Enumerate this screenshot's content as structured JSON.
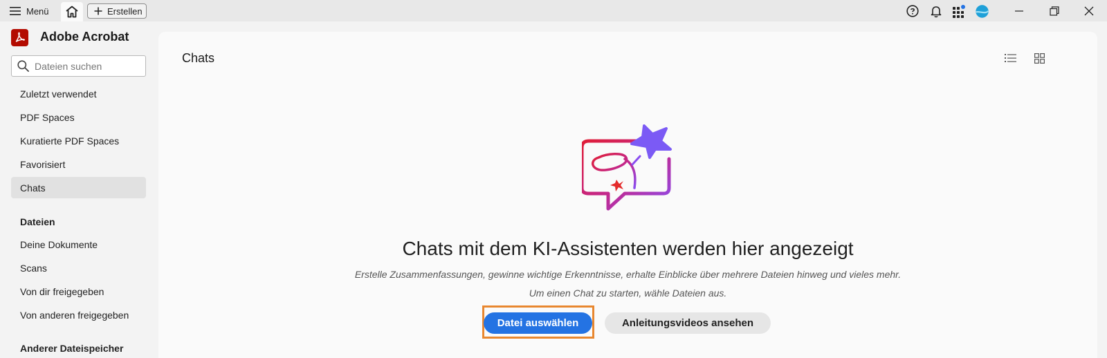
{
  "titlebar": {
    "menu_label": "Menü",
    "create_label": "Erstellen"
  },
  "sidebar": {
    "app_title": "Adobe Acrobat",
    "search_placeholder": "Dateien suchen",
    "nav": [
      {
        "label": "Zuletzt verwendet",
        "active": false
      },
      {
        "label": "PDF Spaces",
        "active": false
      },
      {
        "label": "Kuratierte PDF Spaces",
        "active": false
      },
      {
        "label": "Favorisiert",
        "active": false
      },
      {
        "label": "Chats",
        "active": true
      }
    ],
    "files_heading": "Dateien",
    "files": [
      {
        "label": "Deine Dokumente"
      },
      {
        "label": "Scans"
      },
      {
        "label": "Von dir freigegeben"
      },
      {
        "label": "Von anderen freigegeben"
      }
    ],
    "other_storage_heading": "Anderer Dateispeicher"
  },
  "main": {
    "page_title": "Chats",
    "empty_state": {
      "title": "Chats mit dem KI-Assistenten werden hier angezeigt",
      "description": "Erstelle Zusammenfassungen, gewinne wichtige Erkenntnisse, erhalte Einblicke über mehrere Dateien hinweg und vieles mehr.",
      "hint": "Um einen Chat zu starten, wähle Dateien aus.",
      "primary_button": "Datei auswählen",
      "secondary_button": "Anleitungsvideos ansehen"
    }
  },
  "icons": {
    "menu": "hamburger-icon",
    "home": "home-icon",
    "create": "plus-icon",
    "help": "help-icon",
    "notifications": "bell-icon",
    "apps": "apps-grid-icon",
    "profile": "avatar",
    "search": "search-icon",
    "list_view": "list-view-icon",
    "grid_view": "grid-view-icon"
  },
  "colors": {
    "brand": "#b30b00",
    "primary": "#2473e3",
    "highlight": "#e8872f",
    "active_nav": "#e1e1e1"
  }
}
